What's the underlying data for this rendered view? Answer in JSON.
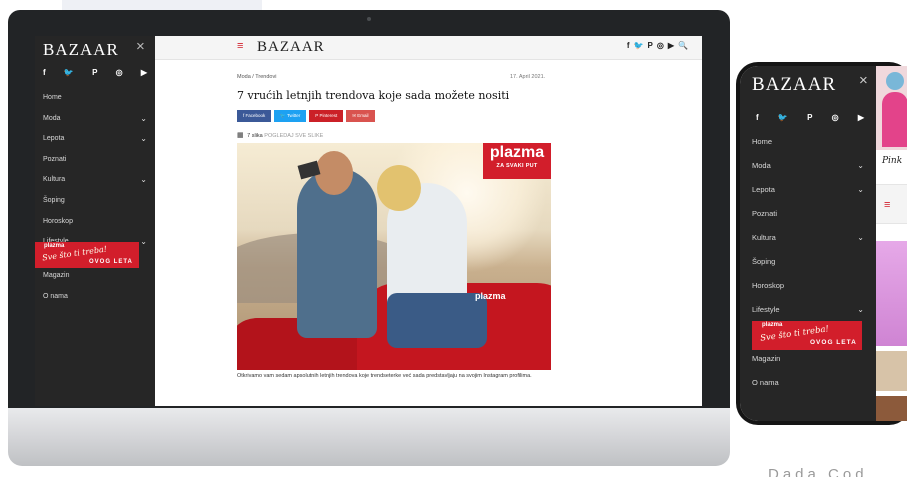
{
  "desktop": {
    "sidebar": {
      "logo": "BAZAAR",
      "close_icon": "×",
      "social": [
        {
          "icon": "facebook-icon",
          "glyph": "f"
        },
        {
          "icon": "twitter-icon",
          "glyph": "🐦"
        },
        {
          "icon": "pinterest-icon",
          "glyph": "P"
        },
        {
          "icon": "instagram-icon",
          "glyph": "◎"
        },
        {
          "icon": "youtube-icon",
          "glyph": "▶"
        }
      ],
      "menu": [
        {
          "label": "Home",
          "has_children": false
        },
        {
          "label": "Moda",
          "has_children": true
        },
        {
          "label": "Lepota",
          "has_children": true
        },
        {
          "label": "Poznati",
          "has_children": false
        },
        {
          "label": "Kultura",
          "has_children": true
        },
        {
          "label": "Šoping",
          "has_children": false
        },
        {
          "label": "Horoskop",
          "has_children": false
        },
        {
          "label": "Lifestyle",
          "has_children": true
        }
      ],
      "promo": {
        "brand": "plazma",
        "script": "Sve što ti treba!",
        "tag": "OVOG LETA"
      },
      "menu_after": [
        {
          "label": "Magazin"
        },
        {
          "label": "O nama"
        }
      ]
    },
    "topbar": {
      "menu_icon": "≡",
      "logo": "BAZAAR",
      "icons": [
        "f",
        "🐦",
        "P",
        "◎",
        "▶",
        "🔍"
      ]
    },
    "article": {
      "breadcrumb": "Moda / Trendovi",
      "date": "17. April 2021.",
      "title": "7 vrućih letnjih trendova koje sada možete nositi",
      "share_buttons": [
        {
          "label": "f  Facebook",
          "color": "#3b5998"
        },
        {
          "label": "🐦 Twitter",
          "color": "#1da1f2"
        },
        {
          "label": "P  Pinterest",
          "color": "#cb2027"
        },
        {
          "label": "✉ Email",
          "color": "#d9534f"
        }
      ],
      "gallery_count": "7 slika",
      "gallery_link": "POGLEDAJ SVE SLIKE",
      "ad": {
        "brand": "plazma",
        "slogan": "ZA SVAKI PUT"
      },
      "car_logo": "plazma",
      "caption": "Otkrivamo vam sedam apsolutnih letnjih trendova koje trendseterke već sada predstavljaju na svojim Instagram profilima."
    }
  },
  "phone": {
    "sidebar": {
      "logo": "BAZAAR",
      "close_icon": "×",
      "social": [
        {
          "icon": "facebook-icon",
          "glyph": "f"
        },
        {
          "icon": "twitter-icon",
          "glyph": "🐦"
        },
        {
          "icon": "pinterest-icon",
          "glyph": "P"
        },
        {
          "icon": "instagram-icon",
          "glyph": "◎"
        },
        {
          "icon": "youtube-icon",
          "glyph": "▶"
        }
      ],
      "menu": [
        {
          "label": "Home",
          "has_children": false
        },
        {
          "label": "Moda",
          "has_children": true
        },
        {
          "label": "Lepota",
          "has_children": true
        },
        {
          "label": "Poznati",
          "has_children": false
        },
        {
          "label": "Kultura",
          "has_children": true
        },
        {
          "label": "Šoping",
          "has_children": false
        },
        {
          "label": "Horoskop",
          "has_children": false
        },
        {
          "label": "Lifestyle",
          "has_children": true
        }
      ],
      "promo": {
        "brand": "plazma",
        "script": "Sve što ti treba!",
        "tag": "OVOG LETA"
      },
      "menu_after": [
        {
          "label": "Magazin"
        },
        {
          "label": "O nama"
        }
      ]
    },
    "peek": {
      "text": "Pink",
      "menu_icon": "≡"
    }
  },
  "cropped_caption": "Dada Cod",
  "colors": {
    "accent": "#d21e2b",
    "sidebar": "#262626",
    "bezel": "#222426"
  }
}
